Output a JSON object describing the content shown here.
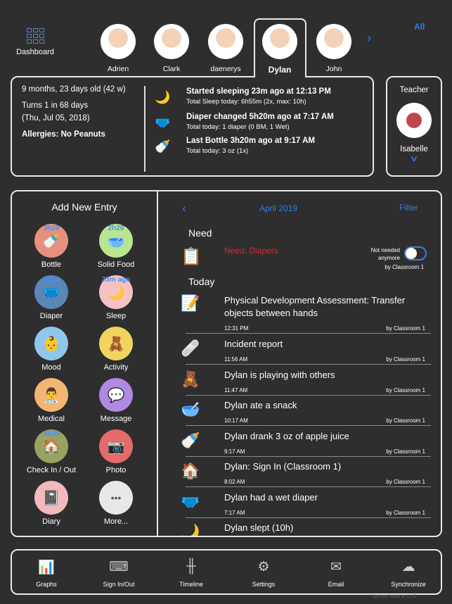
{
  "header": {
    "dashboard_label": "Dashboard",
    "all_label": "All",
    "next_icon": "chevron-right-icon",
    "children": [
      {
        "name": "Adrien"
      },
      {
        "name": "Clark"
      },
      {
        "name": "daenerys"
      },
      {
        "name": "Dylan",
        "selected": true
      },
      {
        "name": "John"
      }
    ]
  },
  "info": {
    "age": "9 months, 23 days old (42 w)",
    "birthday_line1": "Turns 1 in 68 days",
    "birthday_line2": "(Thu, Jul 05, 2018)",
    "allergies": "Allergies: No Peanuts",
    "events": [
      {
        "icon": "moon-icon",
        "title": "Started sleeping 23m ago at 12:13 PM",
        "sub": "Total Sleep today: 6h55m (2x, max: 10h)"
      },
      {
        "icon": "diaper-icon",
        "title": "Diaper changed 5h20m ago at 7:17 AM",
        "sub": "Total today: 1 diaper (0 BM, 1 Wet)"
      },
      {
        "icon": "bottle-icon",
        "title": "Last Bottle 3h20m ago at 9:17 AM",
        "sub": "Total today: 3 oz (1x)"
      }
    ]
  },
  "teacher": {
    "label": "Teacher",
    "name": "Isabelle"
  },
  "add": {
    "title": "Add New Entry",
    "items": [
      {
        "label": "Bottle",
        "badge": "3h20",
        "color": "#e8907f",
        "glyph": "🍼"
      },
      {
        "label": "Solid Food",
        "badge": "2h20",
        "color": "#b9e58f",
        "glyph": "🥣"
      },
      {
        "label": "Diaper",
        "badge": "5h20",
        "color": "#5a86b8",
        "glyph": "🩲"
      },
      {
        "label": "Sleep",
        "badge": "23m ago",
        "color": "#f5c2c4",
        "glyph": "🌙"
      },
      {
        "label": "Mood",
        "badge": "",
        "color": "#8fc6ee",
        "glyph": "👶"
      },
      {
        "label": "Activity",
        "badge": "",
        "color": "#f2d35e",
        "glyph": "🧸"
      },
      {
        "label": "Medical",
        "badge": "",
        "color": "#f2b673",
        "glyph": "👨‍⚕️"
      },
      {
        "label": "Message",
        "badge": "",
        "color": "#b089e0",
        "glyph": "💬"
      },
      {
        "label": "Check In / Out",
        "badge": "4h35",
        "color": "#9aa262",
        "glyph": "🏠"
      },
      {
        "label": "Photo",
        "badge": "",
        "color": "#e56a6a",
        "glyph": "📷"
      },
      {
        "label": "Diary",
        "badge": "",
        "color": "#f3b9bd",
        "glyph": "📓"
      },
      {
        "label": "More...",
        "badge": "",
        "color": "#e8e8e8",
        "glyph": "•••"
      }
    ]
  },
  "timeline": {
    "month": "April 2019",
    "filter_label": "Filter",
    "need_heading": "Need",
    "need_item": "Need: Diapers",
    "need_toggle_label": "Not needed anymore",
    "need_by": "by Classroom 1",
    "today_heading": "Today",
    "accent": "#2f7ee8",
    "need_color": "#e0262b",
    "entries": [
      {
        "icon": "📝",
        "title": "Physical Development Assessment: Transfer objects between hands",
        "time": "12:31 PM",
        "by": "by Classroom 1"
      },
      {
        "icon": "🩹",
        "title": "Incident report",
        "time": "11:56 AM",
        "by": "by Classroom 1"
      },
      {
        "icon": "🧸",
        "title": "Dylan is playing with others",
        "time": "11:47 AM",
        "by": "by Classroom 1"
      },
      {
        "icon": "🥣",
        "title": "Dylan ate a snack",
        "time": "10:17 AM",
        "by": "by Classroom 1"
      },
      {
        "icon": "🍼",
        "title": "Dylan drank 3 oz of apple juice",
        "time": "9:17 AM",
        "by": "by Classroom 1"
      },
      {
        "icon": "🏠",
        "title": "Dylan: Sign In (Classroom 1)",
        "time": "8:02 AM",
        "by": "by Classroom 1"
      },
      {
        "icon": "🩲",
        "title": "Dylan had a wet diaper",
        "time": "7:17 AM",
        "by": "by Classroom 1"
      },
      {
        "icon": "🌙",
        "title": "Dylan slept (10h)",
        "time": "",
        "by": ""
      }
    ]
  },
  "bottom": {
    "items": [
      {
        "label": "Graphs",
        "icon": "bar-chart-icon",
        "glyph": "📊"
      },
      {
        "label": "Sign In/Out",
        "icon": "keypad-icon",
        "glyph": "⌨"
      },
      {
        "label": "Timeline",
        "icon": "timeline-icon",
        "glyph": "╫"
      },
      {
        "label": "Settings",
        "icon": "gear-icon",
        "glyph": "⚙"
      },
      {
        "label": "Email",
        "icon": "envelope-icon",
        "glyph": "✉"
      },
      {
        "label": "Synchronize",
        "icon": "cloud-sync-icon",
        "glyph": "☁"
      }
    ],
    "synced": "Synched: today at 12:35"
  }
}
